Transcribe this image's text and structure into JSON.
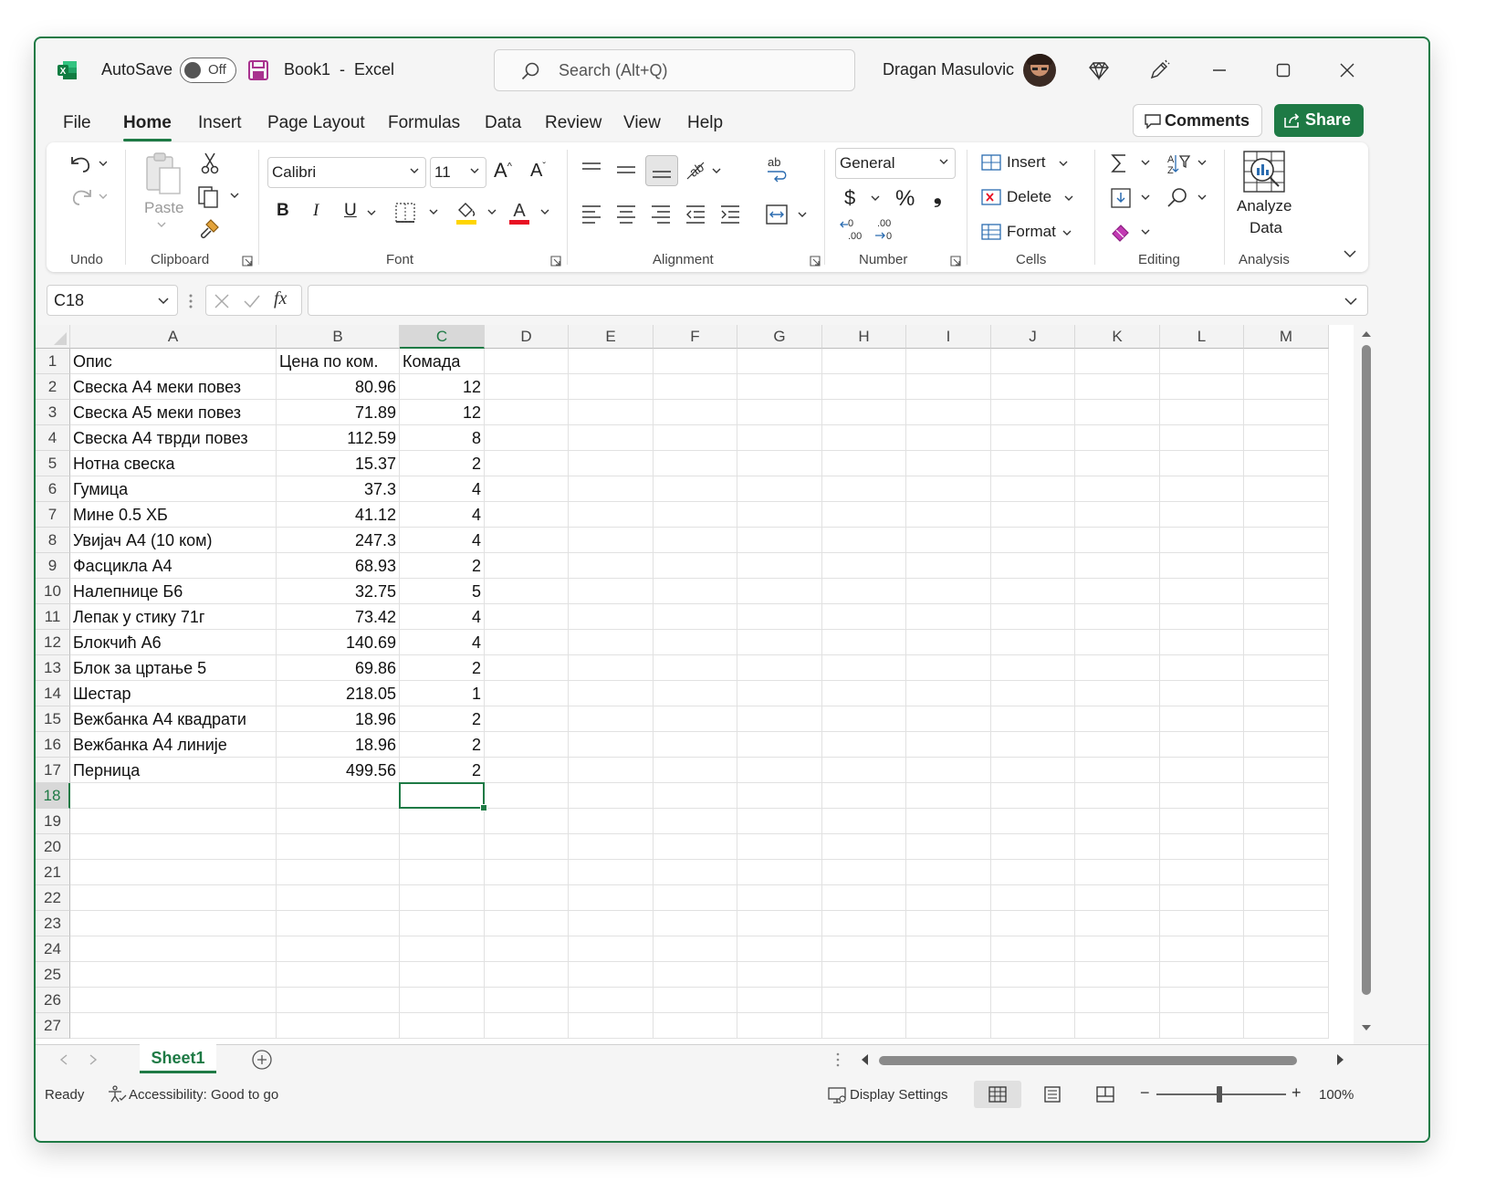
{
  "window": {
    "autosave_label": "AutoSave",
    "autosave_state": "Off",
    "doc_title": "Book1  -  Excel",
    "search_placeholder": "Search (Alt+Q)",
    "user_name": "Dragan Masulovic"
  },
  "menu": {
    "tabs": [
      "File",
      "Home",
      "Insert",
      "Page Layout",
      "Formulas",
      "Data",
      "Review",
      "View",
      "Help"
    ],
    "active_tab": "Home",
    "comments_label": "Comments",
    "share_label": "Share"
  },
  "ribbon": {
    "groups": [
      "Undo",
      "Clipboard",
      "Font",
      "Alignment",
      "Number",
      "Cells",
      "Editing",
      "Analysis"
    ],
    "paste_label": "Paste",
    "font_name": "Calibri",
    "font_size": "11",
    "number_format": "General",
    "currency_symbol": "$",
    "percent_symbol": "%",
    "comma_symbol": "❟",
    "cells_insert": "Insert",
    "cells_delete": "Delete",
    "cells_format": "Format",
    "analyze_line1": "Analyze",
    "analyze_line2": "Data",
    "font_color": "#e81123",
    "highlight_color": "#ffd500"
  },
  "formula_bar": {
    "name_box": "C18",
    "formula": ""
  },
  "sheet": {
    "columns": [
      "A",
      "B",
      "C",
      "D",
      "E",
      "F",
      "G",
      "H",
      "I",
      "J",
      "K",
      "L",
      "M"
    ],
    "selected_column": "C",
    "selected_row": 18,
    "row_numbers": [
      "1",
      "2",
      "3",
      "4",
      "5",
      "6",
      "7",
      "8",
      "9",
      "10",
      "11",
      "12",
      "13",
      "14",
      "15",
      "16",
      "17",
      "18",
      "19",
      "20",
      "21",
      "22",
      "23",
      "24",
      "25",
      "26",
      "27"
    ],
    "header_row": [
      "Опис",
      "Цена по ком.",
      "Комада"
    ],
    "rows": [
      [
        "Свеска А4 меки повез",
        "80.96",
        "12"
      ],
      [
        "Свеска А5 меки повез",
        "71.89",
        "12"
      ],
      [
        "Свеска А4 тврди повез",
        "112.59",
        "8"
      ],
      [
        "Нотна свеска",
        "15.37",
        "2"
      ],
      [
        "Гумица",
        "37.3",
        "4"
      ],
      [
        "Мине 0.5 ХБ",
        "41.12",
        "4"
      ],
      [
        "Увијач А4 (10 ком)",
        "247.3",
        "4"
      ],
      [
        "Фасцикла А4",
        "68.93",
        "2"
      ],
      [
        "Налепнице Б6",
        "32.75",
        "5"
      ],
      [
        "Лепак у стику 71г",
        "73.42",
        "4"
      ],
      [
        "Блокчић А6",
        "140.69",
        "4"
      ],
      [
        "Блок за цртање 5",
        "69.86",
        "2"
      ],
      [
        "Шестар",
        "218.05",
        "1"
      ],
      [
        "Вежбанка А4 квадрати",
        "18.96",
        "2"
      ],
      [
        "Вежбанка А4 линије",
        "18.96",
        "2"
      ],
      [
        "Перница",
        "499.56",
        "2"
      ]
    ],
    "sheet_tab": "Sheet1"
  },
  "status": {
    "ready": "Ready",
    "accessibility": "Accessibility: Good to go",
    "display_settings": "Display Settings",
    "zoom": "100%"
  },
  "colors": {
    "accent": "#1e7a45"
  }
}
